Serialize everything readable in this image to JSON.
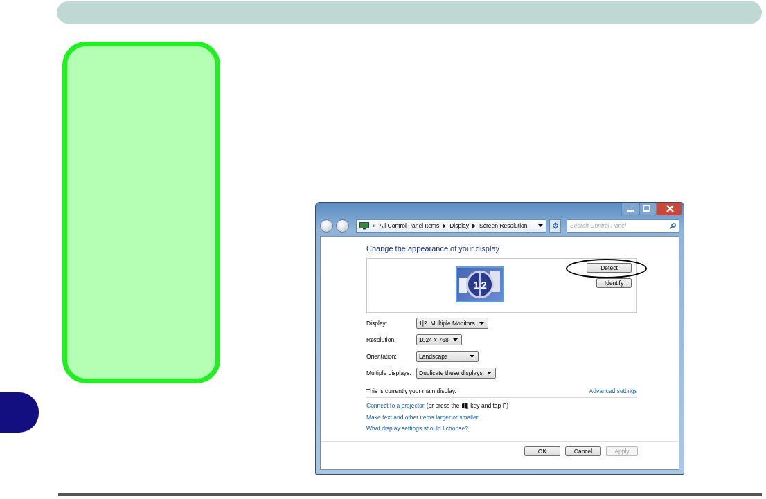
{
  "chapter_tab": {
    "color": "#140f80"
  },
  "side_note": {
    "color": "#b3ffb3"
  },
  "window": {
    "caption_buttons": [
      {
        "kind": "minimize"
      },
      {
        "kind": "maximize"
      },
      {
        "kind": "close"
      }
    ],
    "address": {
      "overflow": "«",
      "crumbs": [
        "All Control Panel Items",
        "Display",
        "Screen Resolution"
      ]
    },
    "search": {
      "placeholder": "Search Control Panel"
    },
    "heading": "Change the appearance of your display",
    "monitor": {
      "numbers": [
        "1",
        "2"
      ]
    },
    "monitor_buttons": [
      {
        "label": "Detect",
        "circled": true
      },
      {
        "label": "Identify",
        "circled": false
      }
    ],
    "settings": [
      {
        "label": "Display:",
        "value": "1|2. Multiple Monitors"
      },
      {
        "label": "Resolution:",
        "value": "1024 × 768"
      },
      {
        "label": "Orientation:",
        "value": "Landscape"
      },
      {
        "label": "Multiple displays:",
        "value": "Duplicate these displays"
      }
    ],
    "main_display_note": "This is currently your main display.",
    "advanced_link": "Advanced settings",
    "projector_line": {
      "link": "Connect to a projector",
      "before_key": "(or press the",
      "after_key": "key and tap P)"
    },
    "links": [
      "Make text and other items larger or smaller",
      "What display settings should I choose?"
    ],
    "buttons": [
      {
        "label": "OK",
        "disabled": false
      },
      {
        "label": "Cancel",
        "disabled": false
      },
      {
        "label": "Apply",
        "disabled": true
      }
    ]
  }
}
